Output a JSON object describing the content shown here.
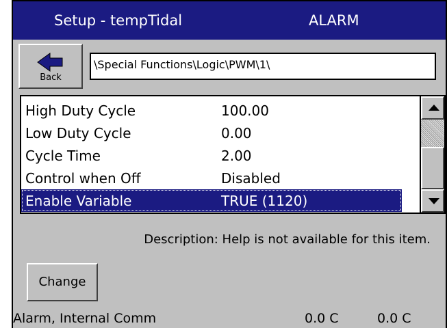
{
  "header": {
    "title": "Setup - tempTidal",
    "status": "ALARM"
  },
  "toolbar": {
    "back_label": "Back",
    "back_icon": "left-arrow-icon"
  },
  "path": "\\Special Functions\\Logic\\PWM\\1\\",
  "settings": [
    {
      "label": "High Duty Cycle",
      "value": "100.00"
    },
    {
      "label": "Low Duty Cycle",
      "value": "0.00"
    },
    {
      "label": "Cycle Time",
      "value": "2.00"
    },
    {
      "label": "Control when Off",
      "value": "Disabled"
    },
    {
      "label": "Enable Variable",
      "value": "TRUE (1120)",
      "selected": true
    }
  ],
  "description": "Description:  Help is not available for this item.",
  "change_label": "Change",
  "statusbar": {
    "message": "Alarm, Internal Comm",
    "temp1": "0.0 C",
    "temp2": "0.0 C"
  },
  "colors": {
    "title_bg": "#1b1b82",
    "panel_bg": "#c0c0c0",
    "selection": "#1b1b82"
  }
}
